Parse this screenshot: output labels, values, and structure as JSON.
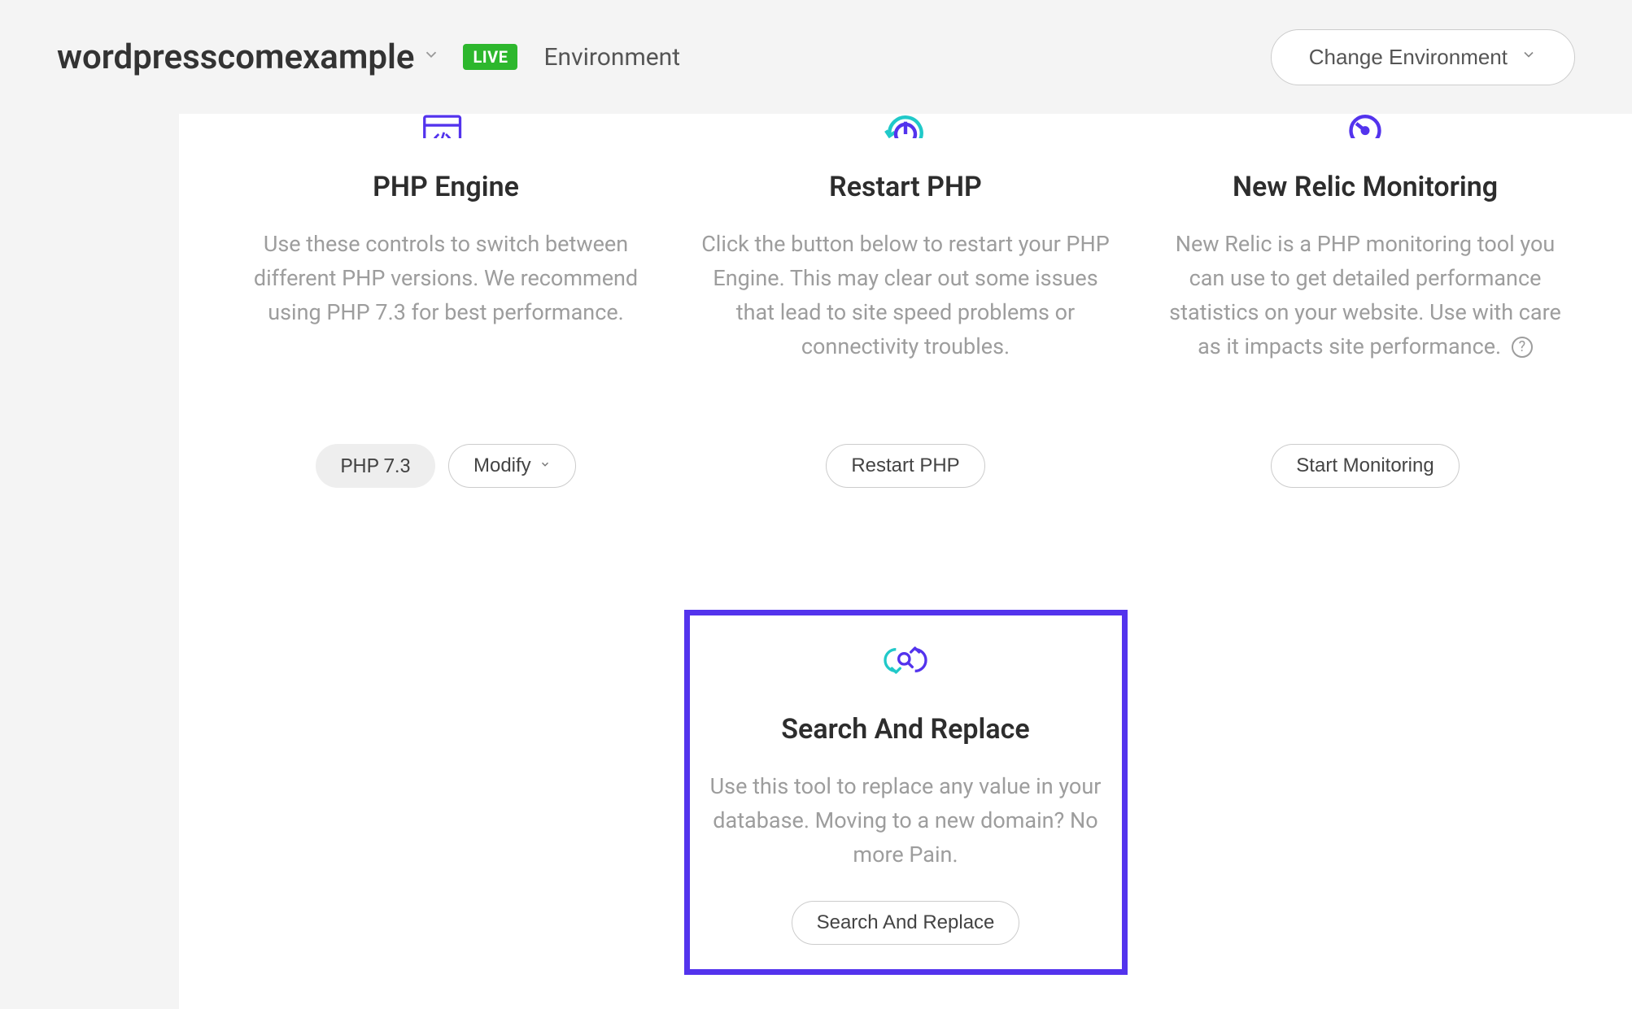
{
  "header": {
    "site_name": "wordpresscomexample",
    "live_badge": "LIVE",
    "env_label": "Environment",
    "change_env_label": "Change Environment"
  },
  "cards": {
    "php_engine": {
      "title": "PHP Engine",
      "desc": "Use these controls to switch between different PHP versions. We recommend using PHP 7.3 for best performance.",
      "version_tag": "PHP 7.3",
      "modify_label": "Modify"
    },
    "restart_php": {
      "title": "Restart PHP",
      "desc": "Click the button below to restart your PHP Engine. This may clear out some issues that lead to site speed problems or connectivity troubles.",
      "button_label": "Restart PHP"
    },
    "new_relic": {
      "title": "New Relic Monitoring",
      "desc": "New Relic is a PHP monitoring tool you can use to get detailed performance statistics on your website. Use with care as it impacts site performance.",
      "button_label": "Start Monitoring"
    },
    "search_replace": {
      "title": "Search And Replace",
      "desc": "Use this tool to replace any value in your database. Moving to a new domain? No more Pain.",
      "button_label": "Search And Replace"
    }
  }
}
